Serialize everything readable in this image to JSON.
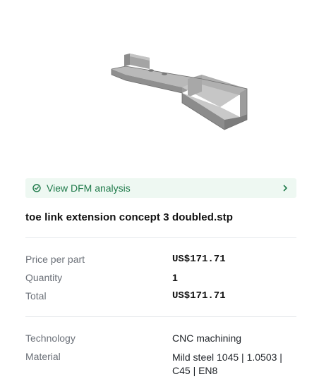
{
  "part": {
    "preview_alt": "toe link extension 3D preview"
  },
  "dfm": {
    "label": "View DFM analysis",
    "icon": "check-circle-icon",
    "chevron": "chevron-right-icon",
    "accent": "#1f7a4a",
    "background": "#eef8f2"
  },
  "file": {
    "name": "toe link extension concept 3 doubled.stp"
  },
  "pricing": {
    "price_label": "Price per part",
    "price_value": "US$171.71",
    "quantity_label": "Quantity",
    "quantity_value": "1",
    "total_label": "Total",
    "total_value": "US$171.71"
  },
  "specs": {
    "technology_label": "Technology",
    "technology_value": "CNC machining",
    "material_label": "Material",
    "material_value": "Mild steel 1045 | 1.0503 | C45 | EN8"
  }
}
